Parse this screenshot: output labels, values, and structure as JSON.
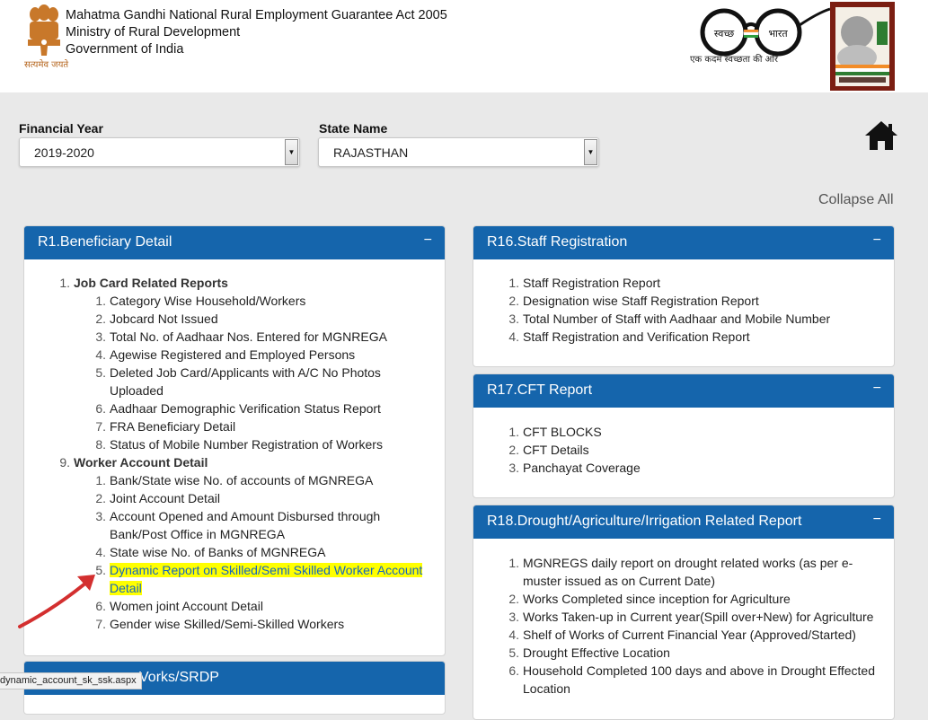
{
  "header": {
    "line1": "Mahatma Gandhi National Rural Employment Guarantee Act 2005",
    "line2": "Ministry of Rural Development",
    "line3": "Government of India",
    "motto": "सत्यमेव जयते",
    "swachh_left": "स्वच्छ",
    "swachh_right": "भारत",
    "swachh_tagline": "एक कदम स्वच्छता की ओर"
  },
  "filters": {
    "financial_year_label": "Financial Year",
    "financial_year_value": "2019-2020",
    "state_label": "State Name",
    "state_value": "RAJASTHAN"
  },
  "collapse_all": "Collapse All",
  "status_url": "dynamic_account_sk_ssk.aspx",
  "colors": {
    "panel_header": "#1565ac",
    "highlight": "#ffff00",
    "link": "#1565c0",
    "arrow": "#d32f2f"
  },
  "icons": {
    "home": "home-icon",
    "dropdown": "dropdown-arrow-icon",
    "collapse": "minus-icon"
  },
  "panels": {
    "r1": {
      "title": "R1.Beneficiary Detail",
      "collapse": "−",
      "group1": {
        "num": "1.",
        "title": "Job Card Related Reports",
        "items": [
          "Category Wise Household/Workers",
          "Jobcard Not Issued",
          "Total No. of Aadhaar Nos. Entered for MGNREGA",
          "Agewise Registered and Employed Persons",
          "Deleted Job Card/Applicants with A/C No Photos Uploaded",
          "Aadhaar Demographic Verification Status Report",
          "FRA Beneficiary Detail",
          "Status of Mobile Number Registration of Workers"
        ]
      },
      "group2": {
        "num": "9.",
        "title": "Worker Account Detail",
        "items": [
          "Bank/State wise No. of accounts of MGNREGA",
          "Joint Account Detail",
          "Account Opened and Amount Disbursed through Bank/Post Office in MGNREGA",
          "State wise No. of Banks of MGNREGA",
          "Dynamic Report on Skilled/Semi Skilled Worker Account Detail",
          "Women joint Account Detail",
          "Gender wise Skilled/Semi-Skilled Workers"
        ]
      }
    },
    "r2": {
      "title_visible": "Vorks/SRDP",
      "collapse": "−"
    },
    "r16": {
      "title": "R16.Staff Registration",
      "collapse": "−",
      "items": [
        "Staff Registration Report",
        "Designation wise Staff Registration Report",
        "Total Number of Staff with Aadhaar and Mobile Number",
        "Staff Registration and Verification Report"
      ]
    },
    "r17": {
      "title": "R17.CFT Report",
      "collapse": "−",
      "items": [
        "CFT BLOCKS",
        "CFT Details",
        "Panchayat Coverage"
      ]
    },
    "r18": {
      "title": "R18.Drought/Agriculture/Irrigation Related Report",
      "collapse": "−",
      "items": [
        "MGNREGS daily report on drought related works (as per e-muster issued as on Current Date)",
        "Works Completed since inception for Agriculture",
        "Works Taken-up in Current year(Spill over+New) for Agriculture",
        "Shelf of Works of Current Financial Year (Approved/Started)",
        "Drought Effective Location",
        "Household Completed 100 days and above in Drought Effected Location"
      ]
    }
  }
}
